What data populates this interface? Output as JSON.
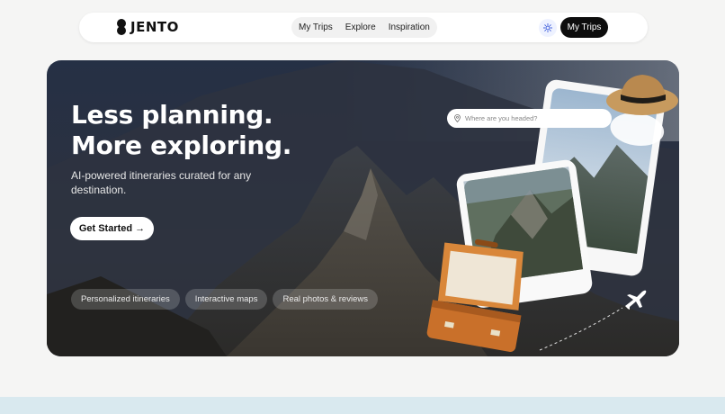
{
  "nav": {
    "logo_text": "JENTO",
    "links": [
      "My Trips",
      "Explore",
      "Inspiration"
    ],
    "cta_label": "My Trips"
  },
  "hero": {
    "headline_line1": "Less planning.",
    "headline_line2": "More exploring.",
    "subtext": "AI-powered itineraries curated for any destination.",
    "cta_label": "Get Started →",
    "chips": [
      "Personalized itineraries",
      "Interactive maps",
      "Real photos & reviews"
    ],
    "search_placeholder": "Where are you headed?"
  },
  "icons": {
    "logo": "logo-icon",
    "theme": "sun-icon",
    "search": "location-pin-icon",
    "plane": "airplane-icon"
  },
  "colors": {
    "primary": "#0d0d0d",
    "bottom_band": "#d9e9ef"
  }
}
